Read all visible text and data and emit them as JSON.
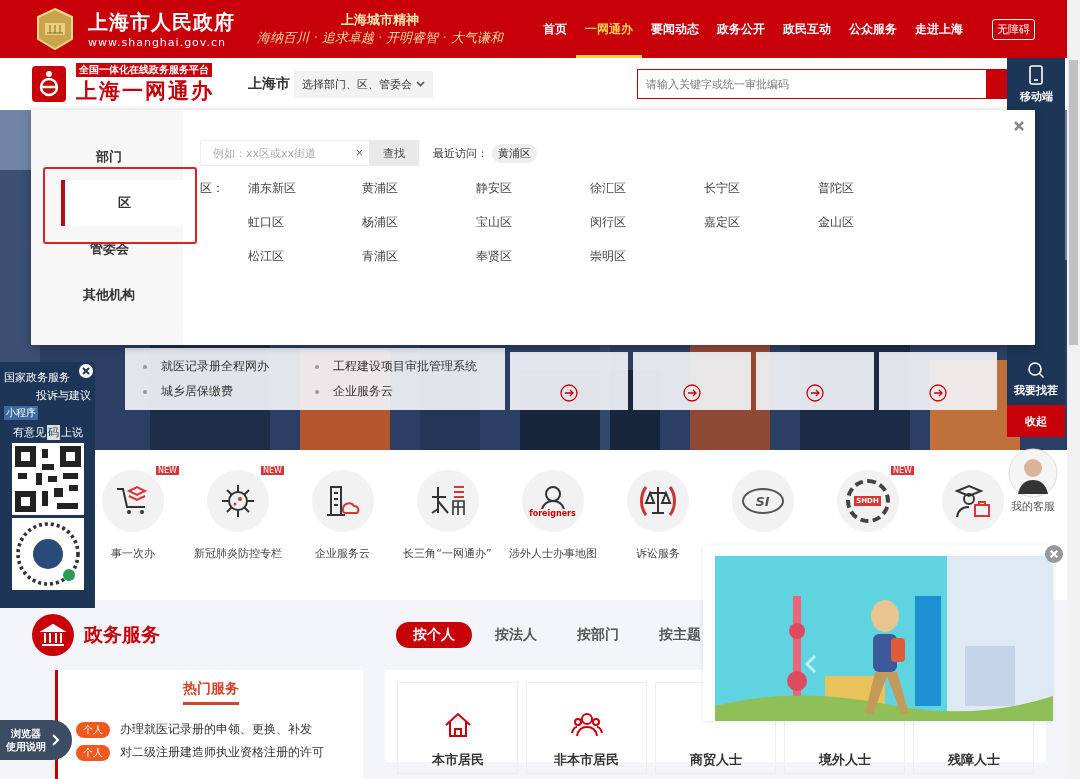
{
  "header": {
    "site_title": "上海市人民政府",
    "site_url": "www.shanghai.gov.cn",
    "motto_title": "上海城市精神",
    "motto": "海纳百川 · 追求卓越 · 开明睿智 · 大气谦和",
    "nav": [
      {
        "label": "首页",
        "selected": false
      },
      {
        "label": "一网通办",
        "selected": true
      },
      {
        "label": "要闻动态",
        "selected": false
      },
      {
        "label": "政务公开",
        "selected": false
      },
      {
        "label": "政民互动",
        "selected": false
      },
      {
        "label": "公众服务",
        "selected": false
      },
      {
        "label": "走进上海",
        "selected": false
      }
    ],
    "accessibility_button": "无障碍"
  },
  "subheader": {
    "platform_tag": "全国一体化在线政务服务平台",
    "platform_name": "上海一网通办",
    "city": "上海市",
    "region_select": "选择部门、区、管委会",
    "search": {
      "placeholder": "请输入关键字或统一审批编码"
    }
  },
  "hero": {
    "links": [
      "就医记录册全程网办",
      "工程建设项目审批管理系统",
      "城乡居保缴费",
      "企业服务云"
    ],
    "cards": [
      {
        "kind": "arrow-card"
      },
      {
        "kind": "arrow-card"
      },
      {
        "kind": "arrow-card"
      },
      {
        "kind": "arrow-card"
      }
    ]
  },
  "region_panel": {
    "tabs": [
      {
        "label": "部门",
        "selected": false
      },
      {
        "label": "区",
        "selected": true
      },
      {
        "label": "管委会",
        "selected": false
      },
      {
        "label": "其他机构",
        "selected": false
      }
    ],
    "search": {
      "placeholder": "例如：xx区或xx街道",
      "clear": "×",
      "button": "查找"
    },
    "recent_label": "最近访问：",
    "recent": [
      "黄浦区"
    ],
    "group_label": "区：",
    "districts": [
      "浦东新区",
      "黄浦区",
      "静安区",
      "徐汇区",
      "长宁区",
      "普陀区",
      "虹口区",
      "杨浦区",
      "宝山区",
      "闵行区",
      "嘉定区",
      "金山区",
      "松江区",
      "青浦区",
      "奉贤区",
      "崇明区"
    ]
  },
  "toolbar": [
    {
      "label": "移动端",
      "kind": "phone"
    },
    {
      "label": "我要找茬",
      "kind": "search"
    },
    {
      "label": "收起",
      "kind": "collapse"
    }
  ],
  "feedback_ad": {
    "org": "国家政务服务",
    "title": "投诉与建议",
    "tag": "小程序",
    "slogan_before": "有意见",
    "slogan_mark": "码",
    "slogan_after": "上说"
  },
  "browser_guide": [
    "浏览器",
    "使用说明"
  ],
  "services": [
    {
      "label": "事一次办",
      "kind": "cart",
      "badge": "NEW"
    },
    {
      "label": "新冠肺炎防控专栏",
      "kind": "virus",
      "badge": "NEW"
    },
    {
      "label": "企业服务云",
      "kind": "building"
    },
    {
      "label": "长三角“一网通办”",
      "kind": "delta"
    },
    {
      "label": "涉外人士办事地图",
      "kind": "foreigners",
      "icon_text": "foreigners"
    },
    {
      "label": "诉讼服务",
      "kind": "scales"
    },
    {
      "kind": "si",
      "icon_text": "SI"
    },
    {
      "kind": "shdh",
      "icon_text": "SHDH",
      "badge": "NEW"
    },
    {
      "kind": "graduate"
    }
  ],
  "support": {
    "label": "我的客服"
  },
  "gov_services": {
    "title": "政务服务",
    "tabs": [
      {
        "label": "按个人",
        "selected": true
      },
      {
        "label": "按法人",
        "selected": false
      },
      {
        "label": "按部门",
        "selected": false
      },
      {
        "label": "按主题",
        "selected": false
      }
    ]
  },
  "hot_services": {
    "title": "热门服务",
    "items": [
      {
        "tag": "个人",
        "text": "办理就医记录册的申领、更换、补发"
      },
      {
        "tag": "个人",
        "text": "对二级注册建造师执业资格注册的许可"
      }
    ]
  },
  "residents": [
    {
      "label": "本市居民",
      "kind": "home"
    },
    {
      "label": "非本市居民",
      "kind": "people"
    },
    {
      "label": "商贸人士"
    },
    {
      "label": "境外人士"
    },
    {
      "label": "残障人士"
    }
  ],
  "promo_popup": {
    "kind": "picture"
  }
}
